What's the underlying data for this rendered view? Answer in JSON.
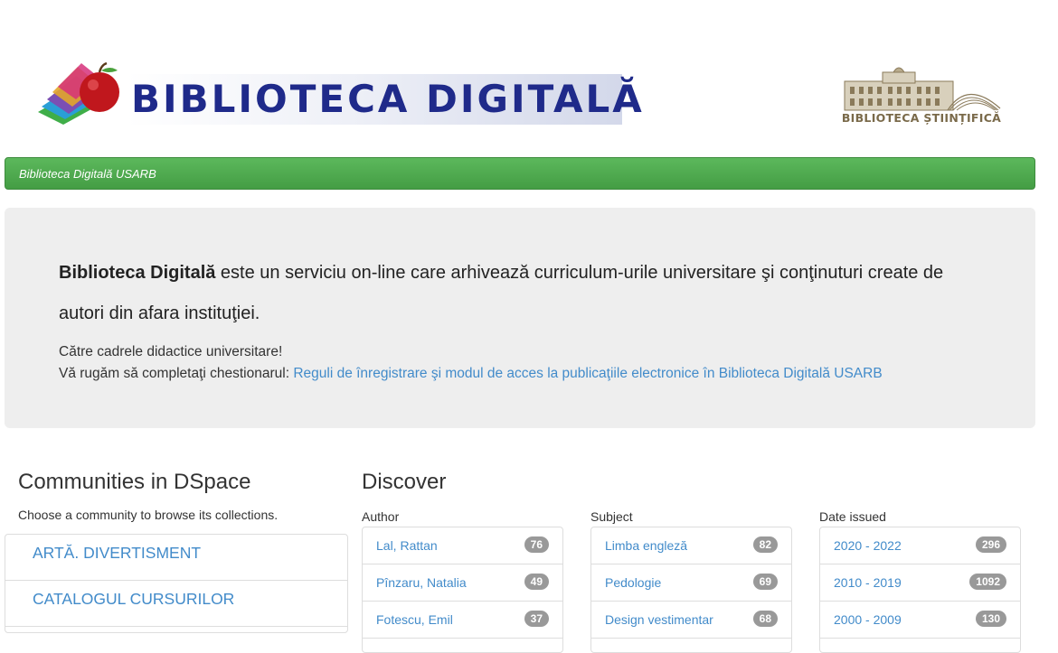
{
  "header": {
    "logo_left_text": "BIBLIOTECA DIGITALĂ",
    "logo_right_text": "BIBLIOTECA ȘTIINȚIFICĂ"
  },
  "navbar": {
    "brand": "Biblioteca Digitală USARB"
  },
  "jumbotron": {
    "lead_bold": "Biblioteca Digitală",
    "lead_rest": " este un serviciu on-line care arhivează curriculum-urile universitare şi conţinuturi create de autori din afara instituţiei.",
    "line1": "Către cadrele didactice universitare!",
    "line2_prefix": "Vă rugăm să completaţi chestionarul: ",
    "link": "Reguli de înregistrare şi modul de acces la publicaţiile electronice în Biblioteca Digitală USARB"
  },
  "communities": {
    "title": "Communities in DSpace",
    "subtitle": "Choose a community to browse its collections.",
    "items": [
      {
        "label": "ARTĂ. DIVERTISMENT"
      },
      {
        "label": "CATALOGUL CURSURILOR"
      }
    ]
  },
  "discover": {
    "title": "Discover",
    "facets": [
      {
        "label": "Author",
        "items": [
          {
            "label": "Lal, Rattan",
            "count": "76"
          },
          {
            "label": "Pînzaru, Natalia",
            "count": "49"
          },
          {
            "label": "Fotescu, Emil",
            "count": "37"
          }
        ]
      },
      {
        "label": "Subject",
        "items": [
          {
            "label": "Limba engleză",
            "count": "82"
          },
          {
            "label": "Pedologie",
            "count": "69"
          },
          {
            "label": "Design vestimentar",
            "count": "68"
          }
        ]
      },
      {
        "label": "Date issued",
        "items": [
          {
            "label": "2020 - 2022",
            "count": "296"
          },
          {
            "label": "2010 - 2019",
            "count": "1092"
          },
          {
            "label": "2000 - 2009",
            "count": "130"
          }
        ]
      }
    ]
  }
}
